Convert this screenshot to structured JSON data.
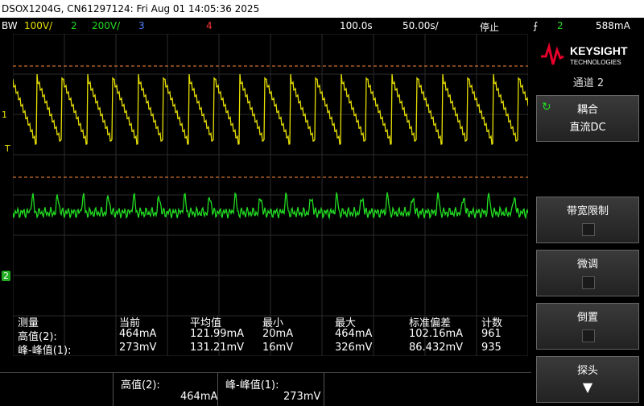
{
  "title": "DSOX1204G, CN61297124: Fri Aug 01 14:05:36 2025",
  "status": {
    "bw": "BW",
    "ch1_scale": "100V/",
    "ch2_num": "2",
    "ch2_scale": "200V/",
    "ch3_num": "3",
    "ch4_num": "4",
    "delay": "100.0s",
    "timebase": "50.00s/",
    "run_state": "停止",
    "trig_channel": "2",
    "trig_level": "588mA"
  },
  "brand": {
    "name": "KEYSIGHT",
    "sub": "TECHNOLOGIES"
  },
  "panel": {
    "title": "通道 2",
    "coupling_label": "耦合",
    "coupling_value": "直流DC",
    "bw_limit_label": "带宽限制",
    "fine_label": "微调",
    "invert_label": "倒置",
    "probe_label": "探头"
  },
  "measurements": {
    "headers": [
      "测量",
      "当前",
      "平均值",
      "最小",
      "最大",
      "标准偏差",
      "计数"
    ],
    "rows": [
      {
        "name": "高值(2):",
        "current": "464mA",
        "mean": "121.99mA",
        "min": "20mA",
        "max": "464mA",
        "std": "102.16mA",
        "count": "961"
      },
      {
        "name": "峰-峰值(1):",
        "current": "273mV",
        "mean": "131.21mV",
        "min": "16mV",
        "max": "326mV",
        "std": "86.432mV",
        "count": "935"
      }
    ]
  },
  "bottom": {
    "m1_label": "高值(2):",
    "m1_value": "464mA",
    "m2_label": "峰-峰值(1):",
    "m2_value": "273mV"
  },
  "markers": {
    "ch1": "1",
    "trig": "T",
    "ch2": "2"
  },
  "colors": {
    "ch1": "#e8e000",
    "ch2": "#22dd22",
    "ch3": "#4f7dff",
    "ch4": "#ff3333",
    "cursor": "#ff8a3a"
  }
}
